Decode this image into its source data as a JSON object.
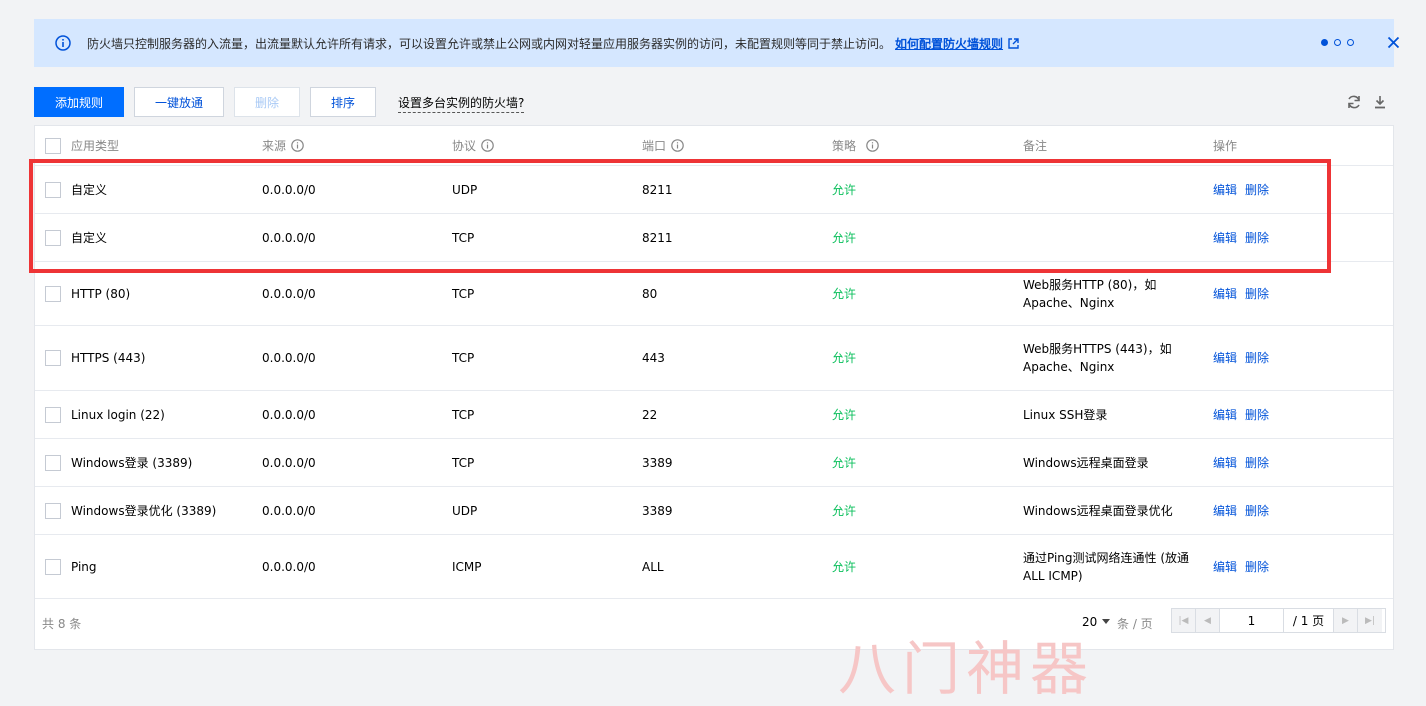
{
  "notice": {
    "text": "防火墙只控制服务器的入流量，出流量默认允许所有请求，可以设置允许或禁止公网或内网对轻量应用服务器实例的访问，未配置规则等同于禁止访问。",
    "link": "如何配置防火墙规则"
  },
  "toolbar": {
    "add": "添加规则",
    "open_all": "一键放通",
    "delete": "删除",
    "sort": "排序",
    "multi": "设置多台实例的防火墙?"
  },
  "headers": {
    "type": "应用类型",
    "source": "来源",
    "protocol": "协议",
    "port": "端口",
    "policy": "策略",
    "note": "备注",
    "ops": "操作"
  },
  "rows": [
    {
      "type": "自定义",
      "source": "0.0.0.0/0",
      "protocol": "UDP",
      "port": "8211",
      "policy": "允许",
      "note1": "",
      "note2": "",
      "edit": "编辑",
      "del": "删除"
    },
    {
      "type": "自定义",
      "source": "0.0.0.0/0",
      "protocol": "TCP",
      "port": "8211",
      "policy": "允许",
      "note1": "",
      "note2": "",
      "edit": "编辑",
      "del": "删除"
    },
    {
      "type": "HTTP (80)",
      "source": "0.0.0.0/0",
      "protocol": "TCP",
      "port": "80",
      "policy": "允许",
      "note1": "Web服务HTTP (80)，如",
      "note2": "Apache、Nginx",
      "edit": "编辑",
      "del": "删除"
    },
    {
      "type": "HTTPS (443)",
      "source": "0.0.0.0/0",
      "protocol": "TCP",
      "port": "443",
      "policy": "允许",
      "note1": "Web服务HTTPS (443)，如",
      "note2": "Apache、Nginx",
      "edit": "编辑",
      "del": "删除"
    },
    {
      "type": "Linux login (22)",
      "source": "0.0.0.0/0",
      "protocol": "TCP",
      "port": "22",
      "policy": "允许",
      "note1": "Linux SSH登录",
      "note2": "",
      "edit": "编辑",
      "del": "删除"
    },
    {
      "type": "Windows登录 (3389)",
      "source": "0.0.0.0/0",
      "protocol": "TCP",
      "port": "3389",
      "policy": "允许",
      "note1": "Windows远程桌面登录",
      "note2": "",
      "edit": "编辑",
      "del": "删除"
    },
    {
      "type": "Windows登录优化 (3389)",
      "source": "0.0.0.0/0",
      "protocol": "UDP",
      "port": "3389",
      "policy": "允许",
      "note1": "Windows远程桌面登录优化",
      "note2": "",
      "edit": "编辑",
      "del": "删除"
    },
    {
      "type": "Ping",
      "source": "0.0.0.0/0",
      "protocol": "ICMP",
      "port": "ALL",
      "policy": "允许",
      "note1": "通过Ping测试网络连通性 (放通",
      "note2": "ALL ICMP)",
      "edit": "编辑",
      "del": "删除"
    }
  ],
  "footer": {
    "total": "共 8 条",
    "page_size": "20",
    "per_page": "条 / 页",
    "page": "1",
    "page_total": "/ 1 页"
  },
  "watermark": "八门神器",
  "colors": {
    "accent": "#006eff",
    "link": "#0052d9",
    "allow": "#0abf5b",
    "highlight": "#ee3436",
    "notice_bg": "#d5e7ff"
  }
}
